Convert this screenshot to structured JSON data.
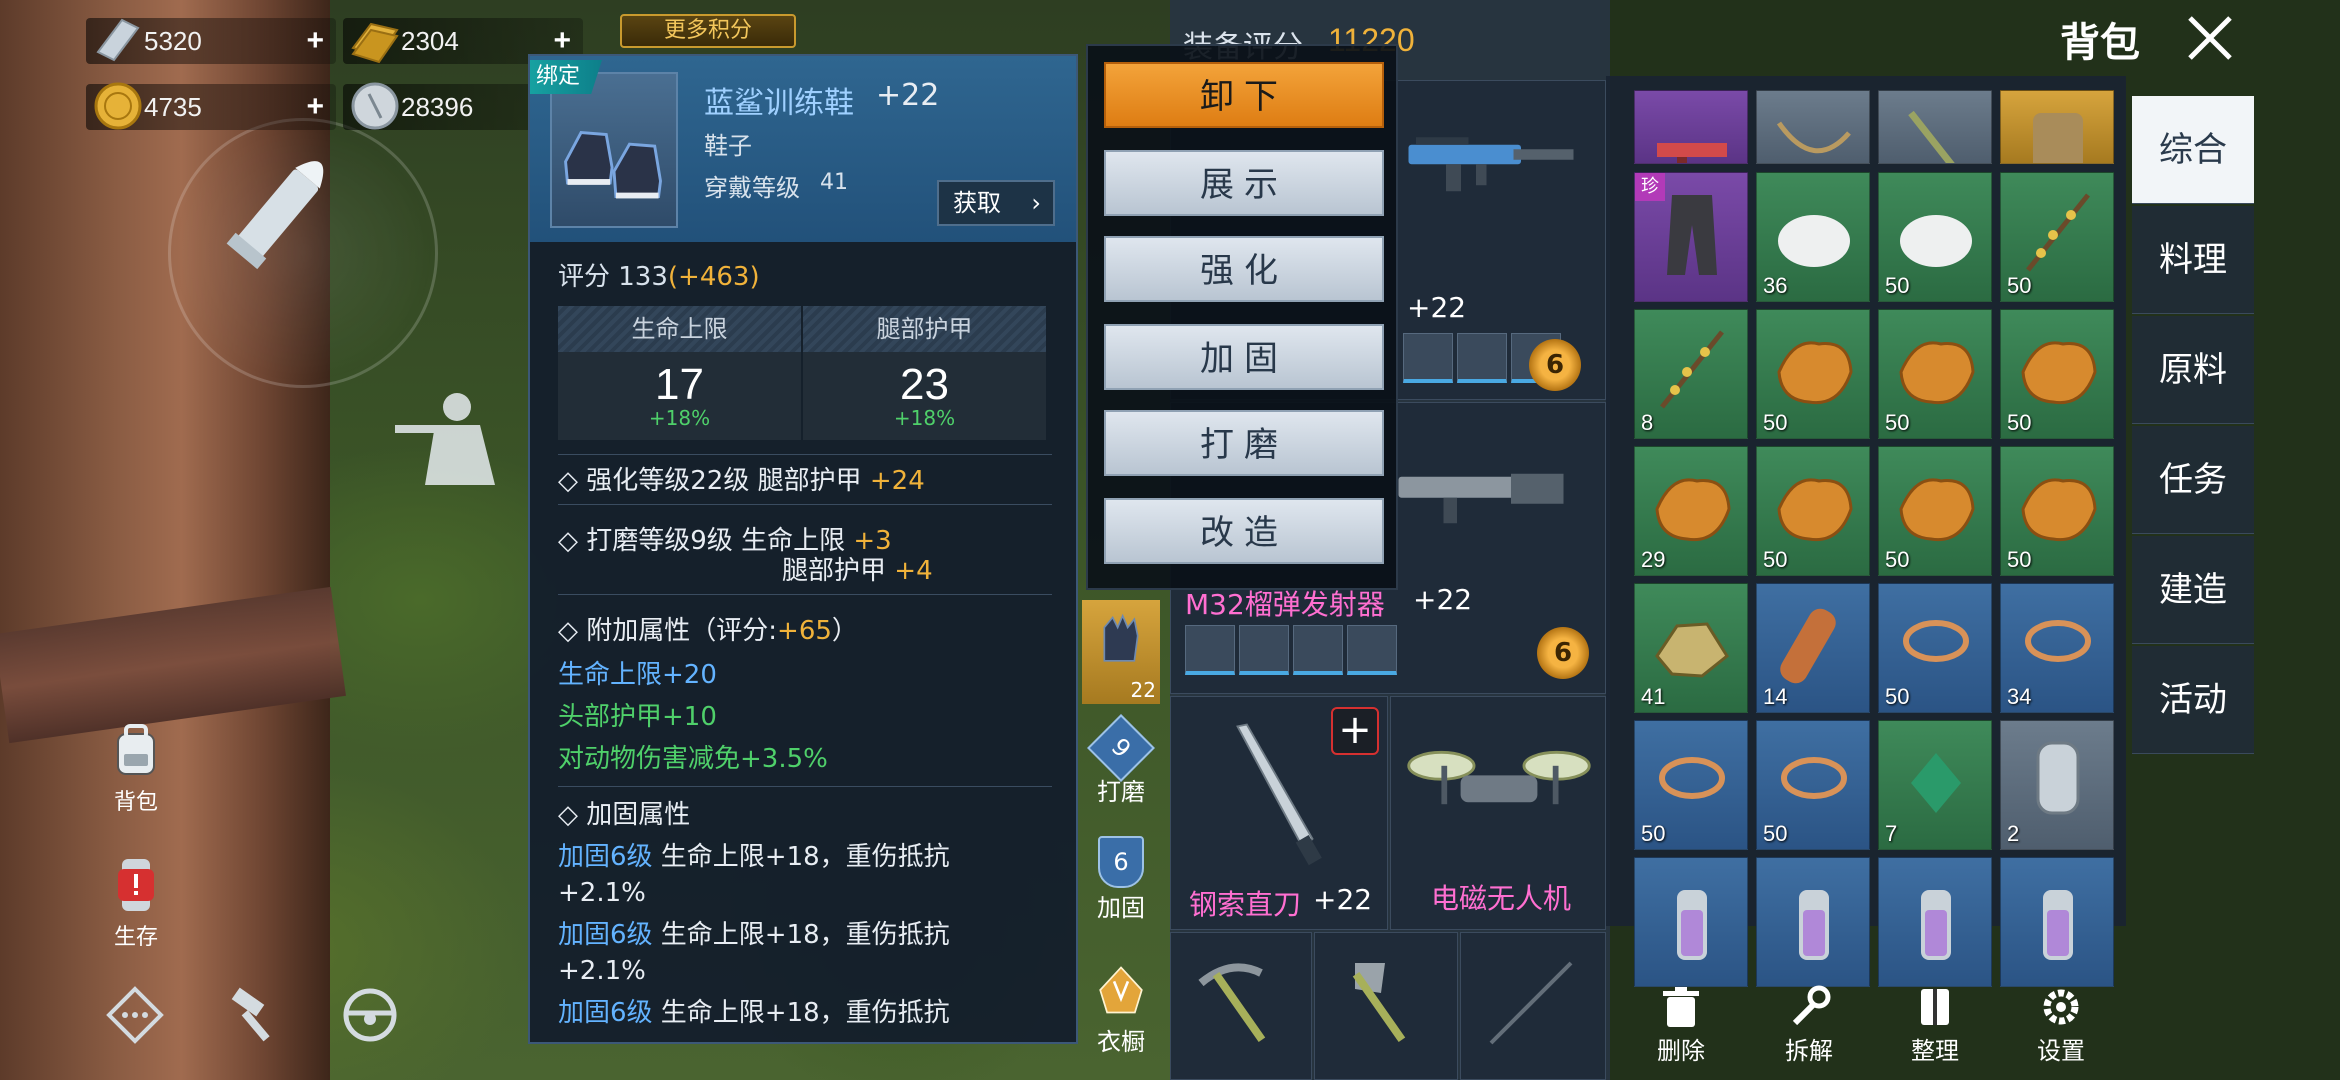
{
  "currencies": {
    "silver_bar": "5320",
    "gold_bar": "2304",
    "gold_coin": "4735",
    "silver_coin": "28396",
    "plus": "+",
    "more_points_label": "更多积分"
  },
  "hud": {
    "bag_label": "背包",
    "survive_label": "生存"
  },
  "tooltip": {
    "bind_tag": "绑定",
    "item_name": "蓝鲨训练鞋",
    "item_plus": "+22",
    "item_type": "鞋子",
    "level_label": "穿戴等级",
    "level_value": "41",
    "obtain_label": "获取",
    "score_label": "评分 133",
    "score_diff": "(+463)",
    "stats": [
      {
        "name": "生命上限",
        "value": "17",
        "pct": "+18%"
      },
      {
        "name": "腿部护甲",
        "value": "23",
        "pct": "+18%"
      }
    ],
    "enhance_line": "◇ 强化等级22级  腿部护甲",
    "enhance_bonus": "+24",
    "polish_line": "◇ 打磨等级9级  生命上限",
    "polish_bonus1": "+3",
    "polish_line2": "腿部护甲",
    "polish_bonus2": "+4",
    "extra_title": "◇ 附加属性（评分:",
    "extra_score": "+65",
    "extra_close": "）",
    "extra_attrs": [
      "生命上限+20",
      "头部护甲+10",
      "对动物伤害减免+3.5%"
    ],
    "reinforce_title": "◇ 加固属性",
    "reinforce_level": "加固6级",
    "reinforce_text": " 生命上限+18，重伤抵抗",
    "reinforce_tail": "+2.1%"
  },
  "actions": {
    "unequip": "卸下",
    "show": "展示",
    "enhance": "强化",
    "reinforce": "加固",
    "polish": "打磨",
    "modify": "改造"
  },
  "equipment": {
    "score_label": "装备评分",
    "score_value": "11220",
    "weapon1_plus": "+22",
    "weapon1_gear": "6",
    "weapon2_name": "M32榴弹发射器",
    "weapon2_plus": "+22",
    "weapon2_gear": "6",
    "melee_name": "钢索直刀",
    "melee_plus": "+22",
    "drone_name": "电磁无人机",
    "glove_level": "22",
    "polish_badge": "9",
    "polish_label": "打磨",
    "reinforce_badge": "6",
    "reinforce_label": "加固",
    "wardrobe_label": "衣橱"
  },
  "inventory": {
    "rare_tag": "珍",
    "rows": [
      [
        "",
        "",
        "",
        ""
      ],
      [
        "",
        "36",
        "50",
        "50"
      ],
      [
        "8",
        "50",
        "50",
        "50"
      ],
      [
        "29",
        "50",
        "50",
        "50"
      ],
      [
        "41",
        "14",
        "50",
        "34"
      ],
      [
        "50",
        "50",
        "7",
        "2"
      ],
      [
        "",
        "",
        "",
        ""
      ]
    ]
  },
  "categories": [
    "综合",
    "料理",
    "原料",
    "任务",
    "建造",
    "活动"
  ],
  "header": {
    "title": "背包"
  },
  "toolbar": {
    "delete": "删除",
    "dismantle": "拆解",
    "sort": "整理",
    "settings": "设置"
  }
}
